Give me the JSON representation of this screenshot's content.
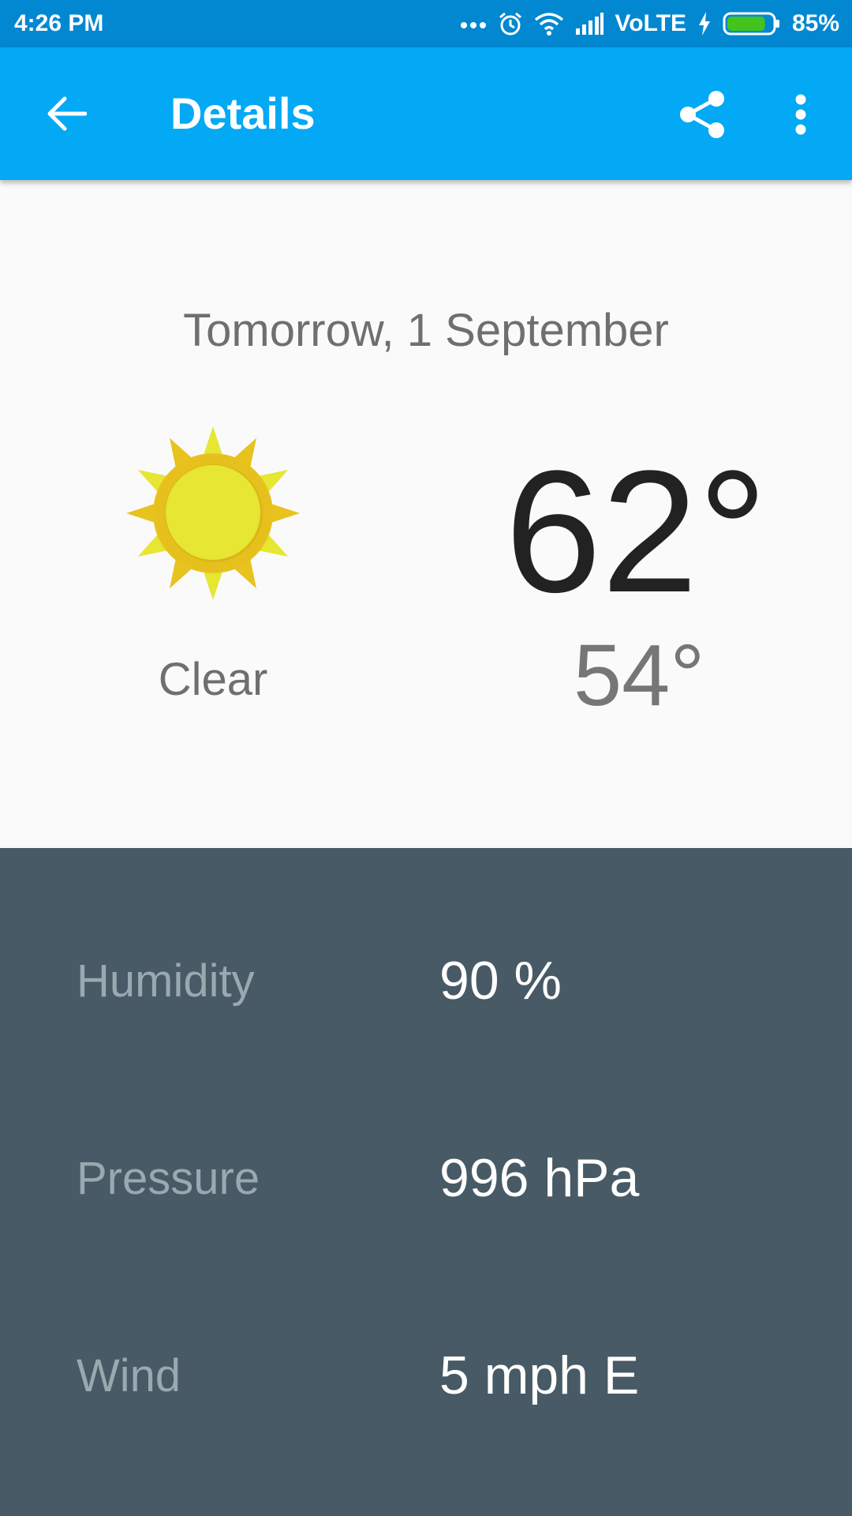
{
  "status_bar": {
    "time": "4:26 PM",
    "network": "VoLTE",
    "battery": "85%",
    "battery_level": 0.85,
    "icons": [
      "more-dots-icon",
      "alarm-icon",
      "wifi-icon",
      "signal-icon",
      "charging-icon",
      "battery-icon"
    ]
  },
  "app_bar": {
    "title": "Details",
    "icons": [
      "back-arrow-icon",
      "share-icon",
      "more-vert-icon"
    ]
  },
  "forecast": {
    "date": "Tomorrow, 1 September",
    "condition": "Clear",
    "condition_icon": "sun-icon",
    "high": "62°",
    "low": "54°"
  },
  "details": [
    {
      "label": "Humidity",
      "value": "90 %"
    },
    {
      "label": "Pressure",
      "value": "996 hPa"
    },
    {
      "label": "Wind",
      "value": "5 mph E"
    }
  ],
  "colors": {
    "status_bar": "#0288d1",
    "app_bar": "#03a9f4",
    "details_panel": "#475a65",
    "sun_outer": "#e8c21e",
    "sun_inner": "#e6e633"
  }
}
